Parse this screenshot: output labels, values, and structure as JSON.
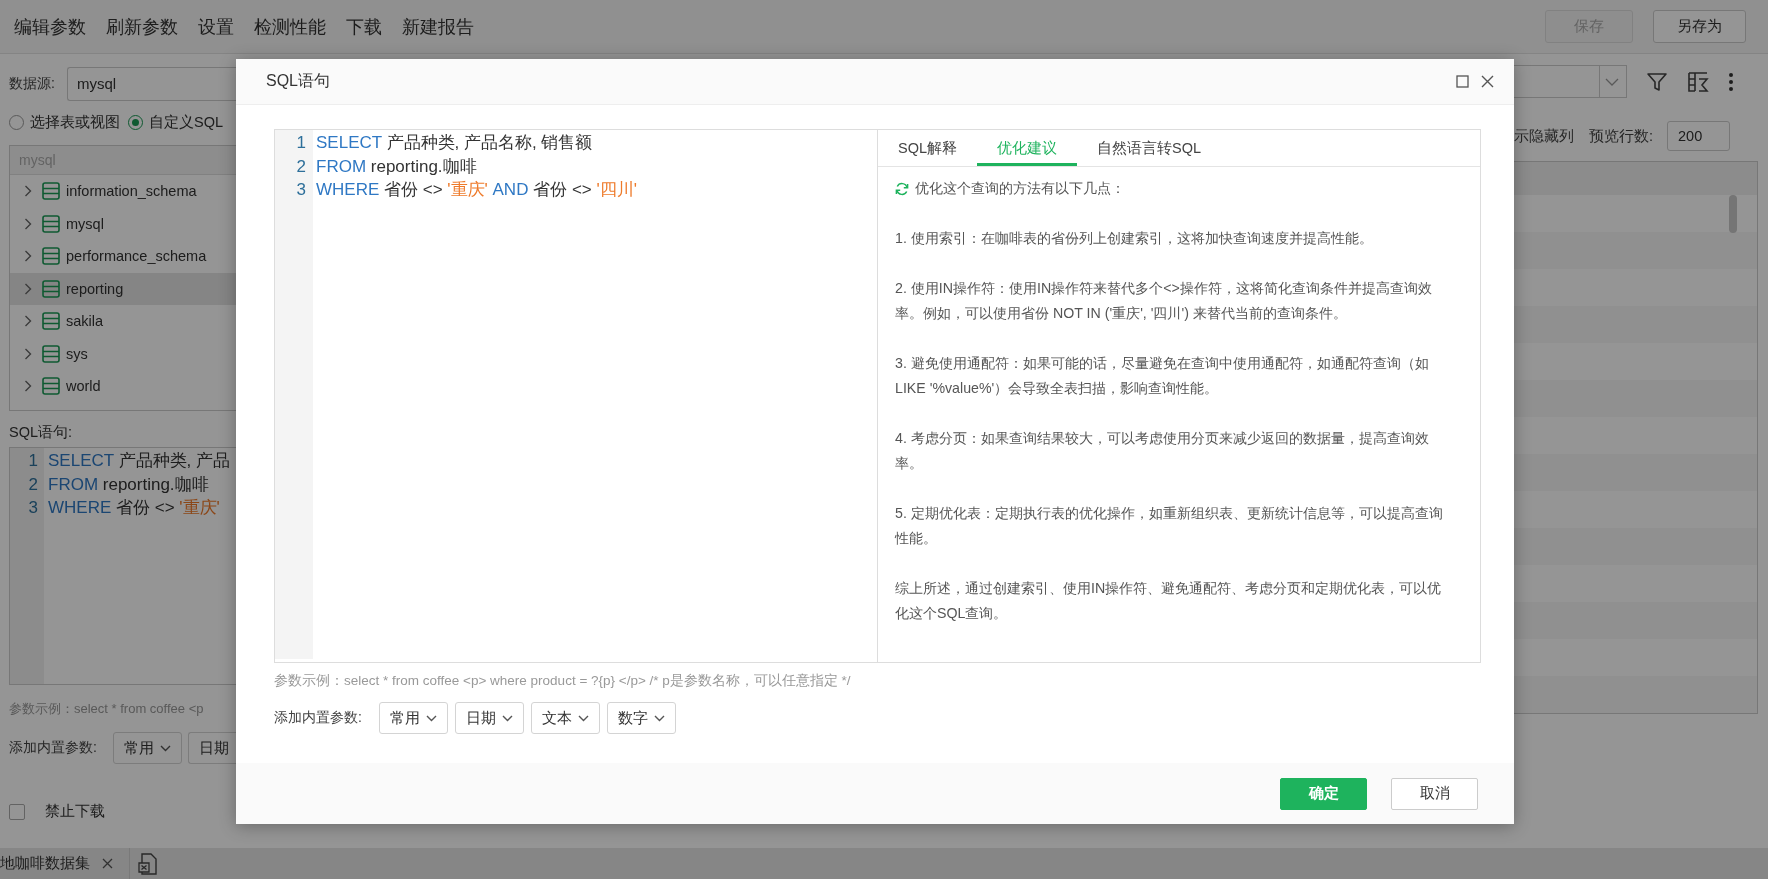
{
  "toolbar": {
    "menu": [
      "编辑参数",
      "刷新参数",
      "设置",
      "检测性能",
      "下载",
      "新建报告"
    ],
    "buttons": [
      {
        "label": "保存",
        "disabled": true
      },
      {
        "label": "另存为",
        "disabled": false
      }
    ]
  },
  "left_panel": {
    "datasource_label": "数据源:",
    "datasource_value": "mysql",
    "source_modes": [
      {
        "label": "选择表或视图",
        "selected": false
      },
      {
        "label": "自定义SQL",
        "selected": true
      }
    ],
    "tree": {
      "header": "mysql",
      "items": [
        {
          "label": "information_schema",
          "selected": false
        },
        {
          "label": "mysql",
          "selected": false
        },
        {
          "label": "performance_schema",
          "selected": false
        },
        {
          "label": "reporting",
          "selected": true
        },
        {
          "label": "sakila",
          "selected": false
        },
        {
          "label": "sys",
          "selected": false
        },
        {
          "label": "world",
          "selected": false
        }
      ]
    },
    "sql_label": "SQL语句:",
    "sql_lines": [
      {
        "number": "1",
        "tokens": [
          {
            "kind": "keyword",
            "text": "SELECT"
          },
          {
            "kind": "plain",
            "text": " 产品种类, 产品"
          }
        ]
      },
      {
        "number": "2",
        "tokens": [
          {
            "kind": "keyword",
            "text": "FROM"
          },
          {
            "kind": "plain",
            "text": " reporting.咖啡"
          }
        ]
      },
      {
        "number": "3",
        "tokens": [
          {
            "kind": "keyword",
            "text": "WHERE"
          },
          {
            "kind": "plain",
            "text": " 省份 <> "
          },
          {
            "kind": "string",
            "text": "'重庆'"
          }
        ]
      }
    ],
    "param_example": "参数示例：select * from coffee <p",
    "param_label": "添加内置参数:",
    "param_buttons": [
      "常用",
      "日期"
    ],
    "disable_download": {
      "label": "禁止下载",
      "checked": false
    }
  },
  "right_panel": {
    "hidden_columns_label": "示隐藏列",
    "preview_rows_label": "预览行数:",
    "preview_rows_value": "200"
  },
  "bottom_tabs": [
    {
      "label": "地咖啡数据集"
    }
  ],
  "dialog": {
    "title": "SQL语句",
    "editor_lines": [
      {
        "number": "1",
        "tokens": [
          {
            "kind": "keyword",
            "text": "SELECT"
          },
          {
            "kind": "plain",
            "text": " 产品种类, 产品名称, 销售额"
          }
        ]
      },
      {
        "number": "2",
        "tokens": [
          {
            "kind": "keyword",
            "text": "FROM"
          },
          {
            "kind": "plain",
            "text": " reporting.咖啡"
          }
        ]
      },
      {
        "number": "3",
        "tokens": [
          {
            "kind": "keyword",
            "text": "WHERE"
          },
          {
            "kind": "plain",
            "text": " 省份 <> "
          },
          {
            "kind": "string",
            "text": "'重庆' "
          },
          {
            "kind": "keyword",
            "text": "AND"
          },
          {
            "kind": "plain",
            "text": " 省份 <> "
          },
          {
            "kind": "string",
            "text": "'四川'"
          }
        ]
      }
    ],
    "tabs": [
      {
        "label": "SQL解释",
        "selected": false
      },
      {
        "label": "优化建议",
        "selected": true
      },
      {
        "label": "自然语言转SQL",
        "selected": false
      }
    ],
    "content": {
      "intro": "优化这个查询的方法有以下几点：",
      "paragraphs": [
        "1. 使用索引：在咖啡表的省份列上创建索引，这将加快查询速度并提高性能。",
        "2. 使用IN操作符：使用IN操作符来替代多个<>操作符，这将简化查询条件并提高查询效率。例如，可以使用省份 NOT IN ('重庆', '四川') 来替代当前的查询条件。",
        "3. 避免使用通配符：如果可能的话，尽量避免在查询中使用通配符，如通配符查询（如LIKE '%value%'）会导致全表扫描，影响查询性能。",
        "4. 考虑分页：如果查询结果较大，可以考虑使用分页来减少返回的数据量，提高查询效率。",
        "5. 定期优化表：定期执行表的优化操作，如重新组织表、更新统计信息等，可以提高查询性能。",
        "综上所述，通过创建索引、使用IN操作符、避免通配符、考虑分页和定期优化表，可以优化这个SQL查询。"
      ]
    },
    "param_example": "参数示例：select * from coffee <p> where product = ?{p} </p> /* p是参数名称，可以任意指定 */",
    "param_label": "添加内置参数:",
    "param_buttons": [
      "常用",
      "日期",
      "文本",
      "数字"
    ],
    "buttons": [
      {
        "label": "确定",
        "kind": "primary"
      },
      {
        "label": "取消",
        "kind": "secondary"
      }
    ]
  }
}
